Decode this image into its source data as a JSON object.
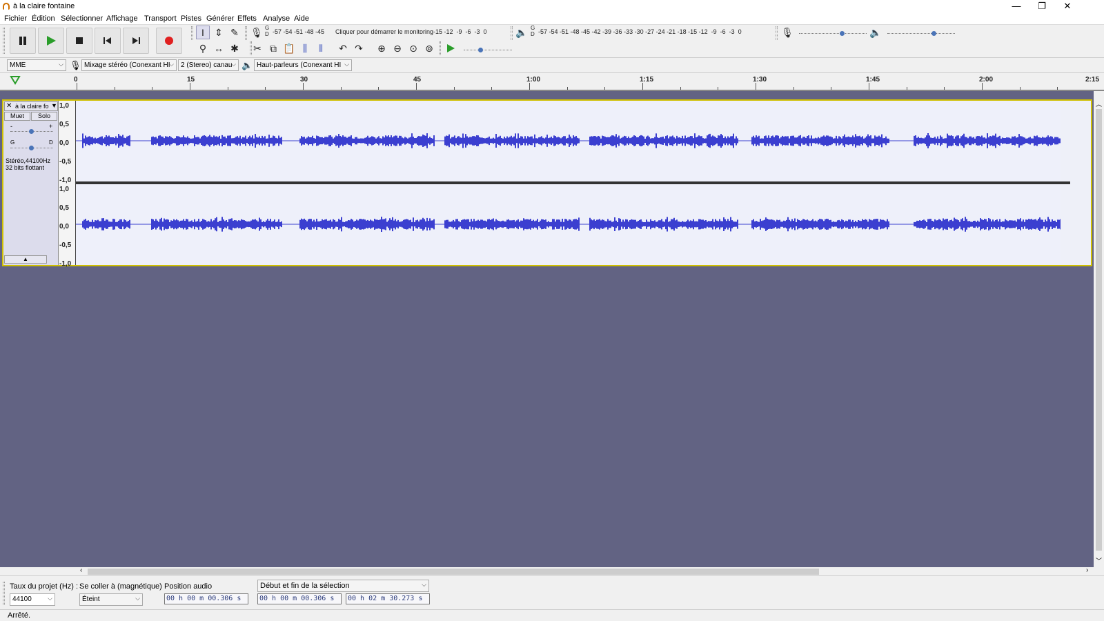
{
  "window": {
    "title": "à la claire fontaine",
    "minimize": "—",
    "restore": "❐",
    "close": "✕"
  },
  "menu": [
    "Fichier",
    "Édition",
    "Sélectionner",
    "Affichage",
    "Transport",
    "Pistes",
    "Générer",
    "Effets",
    "Analyse",
    "Aide"
  ],
  "transport": {
    "pause": "pause-icon",
    "play": "play-icon",
    "stop": "stop-icon",
    "skip_start": "skip-start-icon",
    "skip_end": "skip-end-icon",
    "record": "record-icon"
  },
  "meters": {
    "record_channels": "G\nD",
    "record_scale_left": "-57 -54 -51 -48 -45",
    "record_prompt": "Cliquer pour démarrer le monitoring",
    "record_scale_right": "-15 -12  -9  -6  -3  0",
    "play_channels": "G\nD",
    "play_scale": "-57 -54 -51 -48 -45 -42 -39 -36 -33 -30 -27 -24 -21 -18 -15 -12  -9  -6  -3  0"
  },
  "device": {
    "host": "MME",
    "recording_device": "Mixage stéréo (Conexant HI",
    "channels": "2 (Stereo) canau",
    "playback_device": "Haut-parleurs (Conexant HI"
  },
  "ruler": {
    "ticks": [
      "0",
      "15",
      "30",
      "45",
      "1:00",
      "1:15",
      "1:30",
      "1:45",
      "2:00",
      "2:15"
    ]
  },
  "track": {
    "name": "à la claire fo",
    "mute": "Muet",
    "solo": "Solo",
    "gain_minus": "-",
    "gain_plus": "+",
    "pan_left": "G",
    "pan_right": "D",
    "info_line1": "Stéréo,44100Hz",
    "info_line2": "32 bits flottant",
    "collapse": "▲",
    "vscale": [
      "1,0",
      "0,5",
      "0,0",
      "-0,5",
      "-1,0"
    ],
    "wave_color": "#3b3fd0"
  },
  "selection_toolbar": {
    "rate_label": "Taux du projet (Hz) :",
    "rate_value": "44100",
    "snap_label": "Se coller à (magnétique)",
    "snap_value": "Éteint",
    "position_label": "Position audio",
    "position_value": "00 h 00 m 00.306 s",
    "selection_mode": "Début et fin de la sélection",
    "sel_start": "00 h 00 m 00.306 s",
    "sel_end": "00 h 02 m 30.273 s"
  },
  "status": "Arrêté."
}
